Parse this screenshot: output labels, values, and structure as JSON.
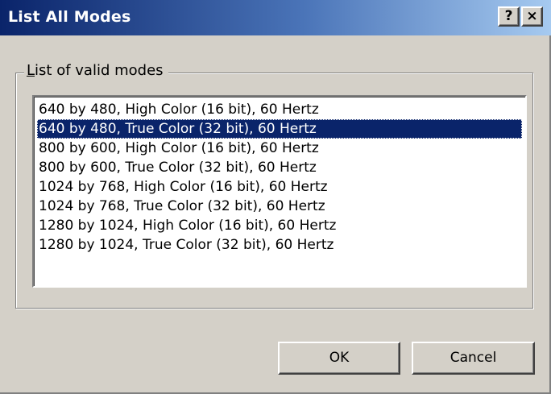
{
  "window": {
    "title": "List All Modes",
    "help_label": "?",
    "close_label": "×"
  },
  "group": {
    "label_accel": "L",
    "label_rest": "ist of valid modes"
  },
  "list": {
    "selected_index": 1,
    "items": [
      "640 by 480, High Color (16 bit), 60 Hertz",
      "640 by 480, True Color (32 bit), 60 Hertz",
      "800 by 600, High Color (16 bit), 60 Hertz",
      "800 by 600, True Color (32 bit), 60 Hertz",
      "1024 by 768, High Color (16 bit), 60 Hertz",
      "1024 by 768, True Color (32 bit), 60 Hertz",
      "1280 by 1024, High Color (16 bit), 60 Hertz",
      "1280 by 1024, True Color (32 bit), 60 Hertz"
    ]
  },
  "buttons": {
    "ok_label": "OK",
    "cancel_label": "Cancel"
  },
  "colors": {
    "titlebar_start": "#0a246a",
    "titlebar_end": "#a6caf0",
    "selection": "#0a246a",
    "face": "#d4d0c8"
  }
}
